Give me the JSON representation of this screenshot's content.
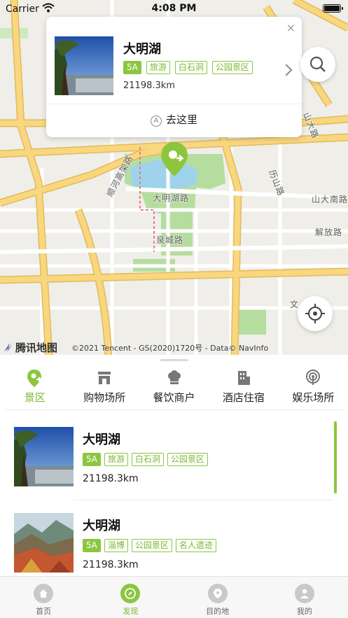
{
  "status_bar": {
    "carrier": "Carrier",
    "time": "4:08 PM"
  },
  "map": {
    "labels": {
      "shunhe_elevated": "顺河高架路",
      "daminghu_road": "大明湖路",
      "lishan_road": "历山路",
      "shanda_road_a": "山大路",
      "shanda_road_b": "山大南路",
      "jiefang_road": "解放路",
      "quancheng_road": "泉城路",
      "wen_road": "文"
    },
    "logo": "腾讯地图",
    "copyright": "©2021 Tencent - GS(2020)1720号 - Data© NavInfo"
  },
  "info_card": {
    "title": "大明湖",
    "tags": [
      "5A",
      "旅游",
      "白石洞",
      "公园景区"
    ],
    "distance": "21198.3km",
    "go_label": "去这里",
    "go_glyph": "A",
    "close": "×"
  },
  "categories": [
    {
      "label": "景区",
      "icon": "scenic-pin-icon",
      "active": true
    },
    {
      "label": "购物场所",
      "icon": "shop-icon",
      "active": false
    },
    {
      "label": "餐饮商户",
      "icon": "chef-hat-icon",
      "active": false
    },
    {
      "label": "酒店住宿",
      "icon": "building-icon",
      "active": false
    },
    {
      "label": "娱乐场所",
      "icon": "broadcast-icon",
      "active": false
    }
  ],
  "poi_list": [
    {
      "title": "大明湖",
      "tags": [
        "5A",
        "旅游",
        "白石洞",
        "公园景区"
      ],
      "distance": "21198.3km"
    },
    {
      "title": "大明湖",
      "tags": [
        "5A",
        "淄博",
        "公园景区",
        "名人遗迹"
      ],
      "distance": "21198.3km"
    }
  ],
  "tabs": [
    {
      "label": "首页",
      "icon": "home-icon",
      "active": false
    },
    {
      "label": "发现",
      "icon": "compass-icon",
      "active": true
    },
    {
      "label": "目的地",
      "icon": "location-pin-icon",
      "active": false
    },
    {
      "label": "我的",
      "icon": "user-icon",
      "active": false
    }
  ],
  "colors": {
    "accent": "#8cc63f",
    "road": "#f6d27a",
    "park": "#b6dda0",
    "water": "#9fd3ec"
  }
}
